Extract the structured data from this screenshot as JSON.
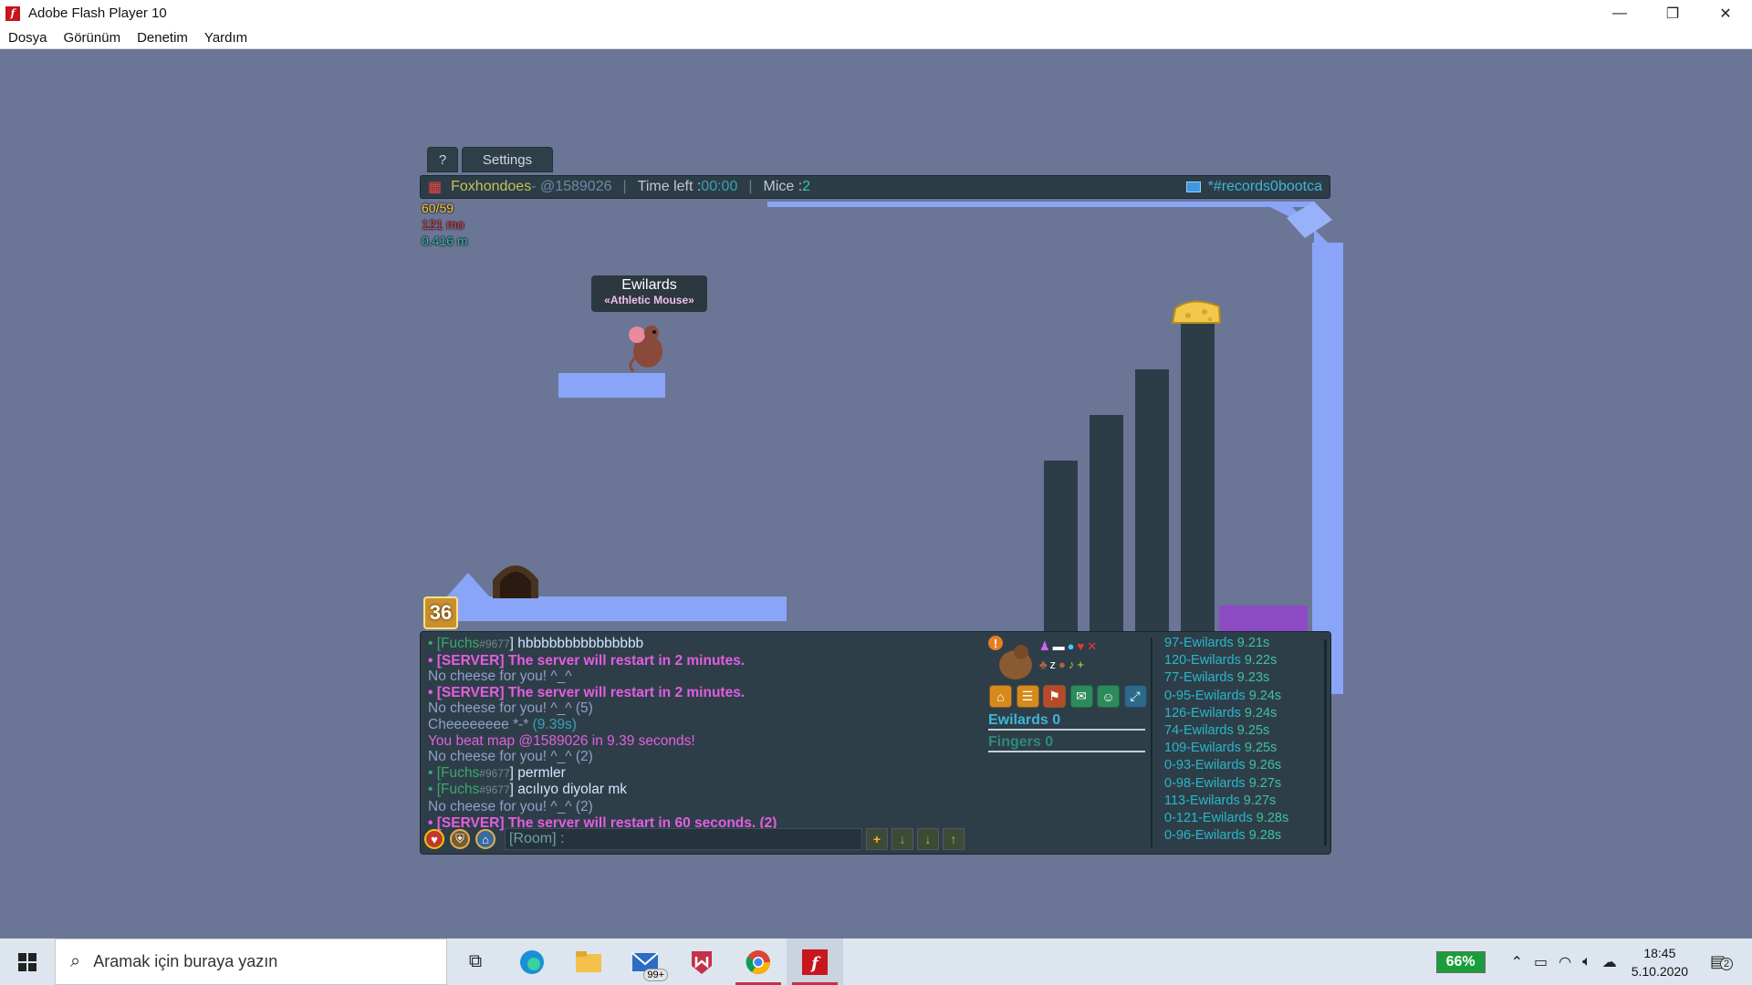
{
  "window": {
    "title": "Adobe Flash Player 10",
    "minimize": "—",
    "restore": "❐",
    "close": "✕"
  },
  "menubar": {
    "items": [
      {
        "label": "Dosya"
      },
      {
        "label": "Görünüm"
      },
      {
        "label": "Denetim"
      },
      {
        "label": "Yardım"
      }
    ]
  },
  "game": {
    "tabs": {
      "help": "?",
      "settings": "Settings"
    },
    "topbar": {
      "player_name": "Foxhondoes",
      "map_code": " - @1589026",
      "time_label": "Time left : ",
      "time_value": "00:00",
      "mice_label": "Mice : ",
      "mice_value": "2",
      "room": "*#records0bootca"
    },
    "stats": {
      "fps": "60/59",
      "ms": "121 mo",
      "mem": "0.416 m"
    },
    "nametag": {
      "name": "Ewilards",
      "title": "«Athletic Mouse»"
    },
    "level": "36"
  },
  "chat": {
    "lines": [
      {
        "type": "user",
        "user": "[Fuchs",
        "tag": "#9677",
        "msg": "] hbbbbbbbbbbbbbbb"
      },
      {
        "type": "server",
        "msg": "• [SERVER] The server will restart in 2 minutes."
      },
      {
        "type": "info",
        "msg": "No cheese for you! ^_^"
      },
      {
        "type": "server",
        "msg": "• [SERVER] The server will restart in 2 minutes."
      },
      {
        "type": "info",
        "msg": "No cheese for you! ^_^ (5)"
      },
      {
        "type": "cheese",
        "msg": "Cheeeeeeee *-* ",
        "time": "(9.39s)"
      },
      {
        "type": "beat",
        "msg": "You beat map @1589026 in 9.39 seconds!"
      },
      {
        "type": "info",
        "msg": "No cheese for you! ^_^ (2)"
      },
      {
        "type": "user",
        "user": "[Fuchs",
        "tag": "#9677",
        "msg": "] permler"
      },
      {
        "type": "user",
        "user": "[Fuchs",
        "tag": "#9677",
        "msg": "] acılıyo diyolar mk"
      },
      {
        "type": "info",
        "msg": "No cheese for you! ^_^ (2)"
      },
      {
        "type": "server",
        "msg": "• [SERVER] The server will restart in 60 seconds. (2)"
      }
    ],
    "bullet": "•",
    "input_placeholder": "[Room] :"
  },
  "scores": {
    "ewilards": "Ewilards 0",
    "fingers": "Fingers 0"
  },
  "records": [
    {
      "name": "97-Ewilards",
      "time": "9.21s"
    },
    {
      "name": "120-Ewilards",
      "time": "9.22s"
    },
    {
      "name": "77-Ewilards",
      "time": "9.23s"
    },
    {
      "name": "0-95-Ewilards",
      "time": "9.24s"
    },
    {
      "name": "126-Ewilards",
      "time": "9.24s"
    },
    {
      "name": "74-Ewilards",
      "time": "9.25s"
    },
    {
      "name": "109-Ewilards",
      "time": "9.25s"
    },
    {
      "name": "0-93-Ewilards",
      "time": "9.26s"
    },
    {
      "name": "0-98-Ewilards",
      "time": "9.27s"
    },
    {
      "name": "113-Ewilards",
      "time": "9.27s"
    },
    {
      "name": "0-121-Ewilards",
      "time": "9.28s"
    },
    {
      "name": "0-96-Ewilards",
      "time": "9.28s"
    }
  ],
  "taskbar": {
    "search_placeholder": "Aramak için buraya yazın",
    "mail_badge": "99+",
    "battery": "66%",
    "time": "18:45",
    "date": "5.10.2020",
    "notif_count": "2"
  },
  "colors": {
    "stage_bg": "#6b7596",
    "platform": "#8aa5f7",
    "pillar": "#2d3d48",
    "panel": "#2e3e49",
    "server_msg": "#e35ee0",
    "goal": "#8c4bc2"
  }
}
